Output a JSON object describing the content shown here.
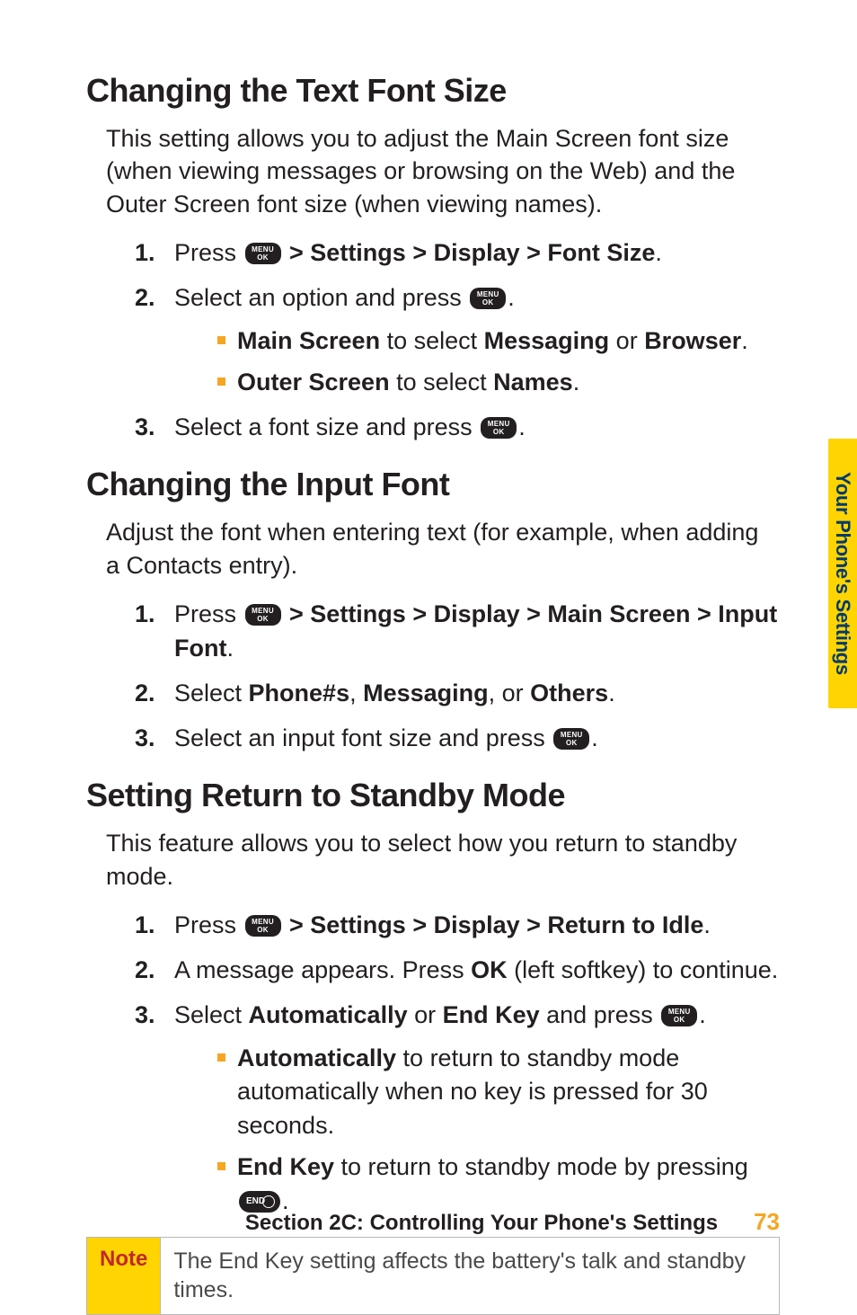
{
  "side_tab": "Your Phone's Settings",
  "sections": [
    {
      "heading": "Changing the Text Font Size",
      "intro": "This setting allows you to adjust the Main Screen font size (when viewing messages or browsing on the Web) and the Outer Screen font size (when viewing names).",
      "steps": [
        {
          "num": "1.",
          "pre": "Press ",
          "icon": "menu",
          "post_strong": " > Settings > Display > Font Size",
          "tail": "."
        },
        {
          "num": "2.",
          "pre": "Select an option and press ",
          "icon": "menu",
          "tail": ".",
          "sub": [
            {
              "parts": [
                {
                  "b": "Main Screen"
                },
                {
                  "t": " to select "
                },
                {
                  "b": "Messaging"
                },
                {
                  "t": " or "
                },
                {
                  "b": "Browser"
                },
                {
                  "t": "."
                }
              ]
            },
            {
              "parts": [
                {
                  "b": "Outer Screen"
                },
                {
                  "t": " to select "
                },
                {
                  "b": "Names"
                },
                {
                  "t": "."
                }
              ]
            }
          ]
        },
        {
          "num": "3.",
          "pre": "Select a font size and press ",
          "icon": "menu",
          "tail": "."
        }
      ]
    },
    {
      "heading": "Changing the Input Font",
      "intro": "Adjust the font when entering text (for example, when adding a Contacts entry).",
      "steps": [
        {
          "num": "1.",
          "pre": "Press ",
          "icon": "menu",
          "post_strong": " > Settings > Display > Main Screen > Input Font",
          "tail": "."
        },
        {
          "num": "2.",
          "parts": [
            {
              "t": "Select "
            },
            {
              "b": "Phone#s"
            },
            {
              "t": ", "
            },
            {
              "b": "Messaging"
            },
            {
              "t": ", or "
            },
            {
              "b": "Others"
            },
            {
              "t": "."
            }
          ]
        },
        {
          "num": "3.",
          "pre": "Select an input font size and press ",
          "icon": "menu",
          "tail": "."
        }
      ]
    },
    {
      "heading": "Setting Return to Standby Mode",
      "intro": "This feature allows you to select how you return to standby mode.",
      "steps": [
        {
          "num": "1.",
          "pre": "Press ",
          "icon": "menu",
          "post_strong": " > Settings > Display > Return to Idle",
          "tail": "."
        },
        {
          "num": "2.",
          "parts": [
            {
              "t": "A message appears. Press "
            },
            {
              "b": "OK"
            },
            {
              "t": " (left softkey) to continue."
            }
          ]
        },
        {
          "num": "3.",
          "parts": [
            {
              "t": "Select "
            },
            {
              "b": "Automatically"
            },
            {
              "t": " or "
            },
            {
              "b": "End Key"
            },
            {
              "t": " and press "
            },
            {
              "icon": "menu"
            },
            {
              "t": "."
            }
          ],
          "sub": [
            {
              "parts": [
                {
                  "b": "Automatically"
                },
                {
                  "t": " to return to standby mode automatically when no key is pressed for 30 seconds."
                }
              ]
            },
            {
              "parts": [
                {
                  "b": "End Key"
                },
                {
                  "t": " to return to standby mode by pressing "
                },
                {
                  "icon": "end"
                },
                {
                  "t": "."
                }
              ]
            }
          ]
        }
      ]
    }
  ],
  "note": {
    "label": "Note",
    "body": "The End Key setting affects the battery's talk and standby times."
  },
  "footer": {
    "title": "Section 2C: Controlling Your Phone's Settings",
    "page": "73"
  }
}
